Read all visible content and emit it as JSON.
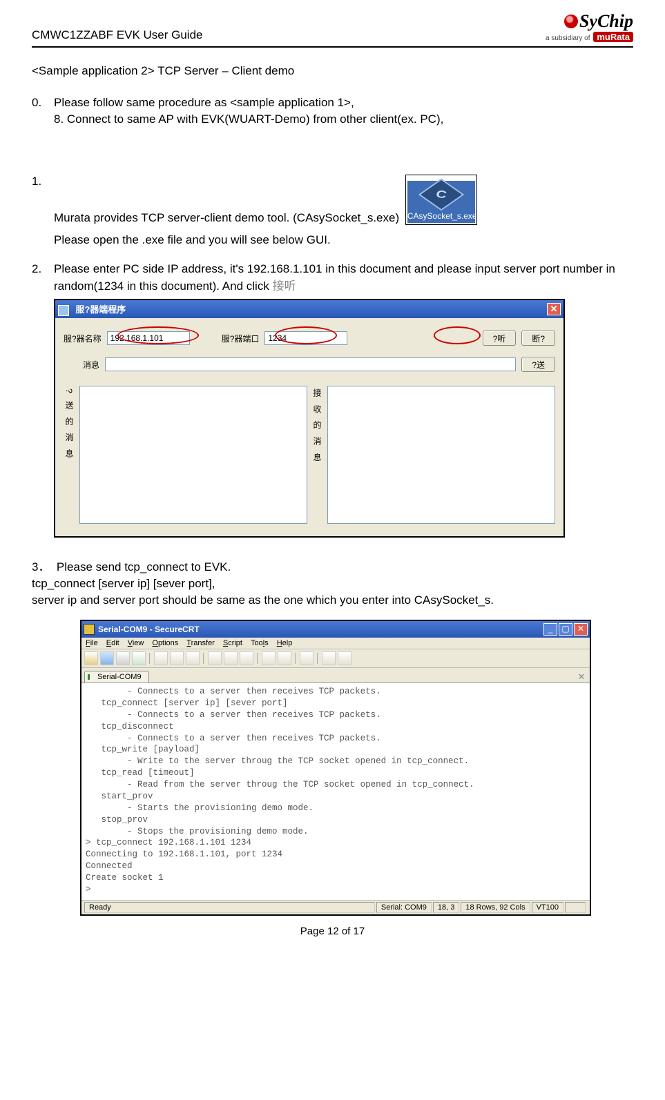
{
  "header": {
    "title": "CMWC1ZZABF EVK User Guide",
    "brand": "SyChip",
    "subsidiary_prefix": "a subsidiary of",
    "subsidiary_brand": "muRata"
  },
  "section": {
    "heading": "<Sample application 2>    TCP Server – Client demo"
  },
  "steps": {
    "s0_num": "0.",
    "s0_line1": "Please follow same procedure as <sample application 1>,",
    "s0_line2": "8. Connect to same AP with EVK(WUART-Demo) from other client(ex. PC),",
    "s1_num": "1.",
    "s1_line1": "Murata provides TCP server-client demo tool. (CAsySocket_s.exe)",
    "s1_line2": "Please open the .exe file and you will see below GUI.",
    "s2_num": "2.",
    "s2_line1": "Please enter PC side IP address, it's 192.168.1.101 in this document and please input server port number in random(1234 in this document). And click ",
    "s2_gray": "接听",
    "s3_num": "3．",
    "s3_line1": "Please send tcp_connect to EVK.",
    "s3_line2": "tcp_connect [server ip] [sever port],",
    "s3_line3": "server ip and server port should be same as the one which you enter into CAsySocket_s."
  },
  "icon": {
    "label": "CAsySocket_s.exe"
  },
  "dialog1": {
    "title": "服?器端程序",
    "lbl_server_name": "服?器名称",
    "val_server_name": "192.168.1.101",
    "lbl_server_port": "服?器端口",
    "val_server_port": "1234",
    "btn_listen": "?听",
    "btn_disconnect": "断?",
    "lbl_message": "消息",
    "btn_send": "?送",
    "lbl_sent": "? 送 的 消 息",
    "lbl_recv": "接 收 的 消 息"
  },
  "crt": {
    "title": "Serial-COM9 - SecureCRT",
    "menus": [
      "File",
      "Edit",
      "View",
      "Options",
      "Transfer",
      "Script",
      "Tools",
      "Help"
    ],
    "tab": "Serial-COM9",
    "console": "        - Connects to a server then receives TCP packets.\n   tcp_connect [server ip] [sever port]\n        - Connects to a server then receives TCP packets.\n   tcp_disconnect\n        - Connects to a server then receives TCP packets.\n   tcp_write [payload]\n        - Write to the server throug the TCP socket opened in tcp_connect.\n   tcp_read [timeout]\n        - Read from the server throug the TCP socket opened in tcp_connect.\n   start_prov\n        - Starts the provisioning demo mode.\n   stop_prov\n        - Stops the provisioning demo mode.\n> tcp_connect 192.168.1.101 1234\nConnecting to 192.168.1.101, port 1234\nConnected\nCreate socket 1\n>",
    "status": {
      "ready": "Ready",
      "serial": "Serial: COM9",
      "pos": "18,  3",
      "dim": "18 Rows,  92 Cols",
      "term": "VT100"
    }
  },
  "footer": {
    "text": "Page 12 of 17"
  }
}
